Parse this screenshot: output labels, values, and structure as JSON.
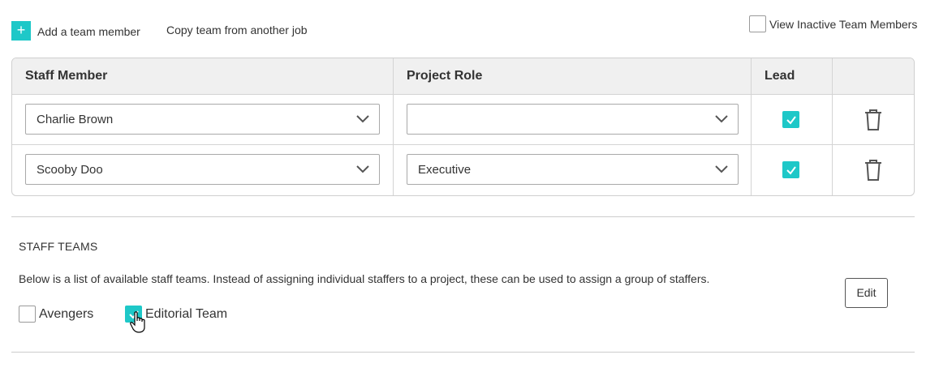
{
  "toolbar": {
    "add_label": "Add a team member",
    "add_icon": "+",
    "copy_label": "Copy team from another job",
    "view_inactive_label": "View Inactive Team Members",
    "view_inactive_checked": false
  },
  "table": {
    "headers": {
      "staff": "Staff Member",
      "role": "Project Role",
      "lead": "Lead",
      "actions": ""
    },
    "rows": [
      {
        "staff": "Charlie Brown",
        "role": "",
        "lead": true
      },
      {
        "staff": "Scooby Doo",
        "role": "Executive",
        "lead": true
      }
    ]
  },
  "staff_teams": {
    "title": "STAFF TEAMS",
    "description": "Below is a list of available staff teams. Instead of assigning individual staffers to a project, these can be used to assign a group of staffers.",
    "edit_label": "Edit",
    "teams": [
      {
        "name": "Avengers",
        "checked": false
      },
      {
        "name": "Editorial Team",
        "checked": true
      }
    ]
  },
  "colors": {
    "accent": "#1ec8c8",
    "text": "#333333",
    "border": "#cfcfcf",
    "header_bg": "#f0f0f0"
  }
}
